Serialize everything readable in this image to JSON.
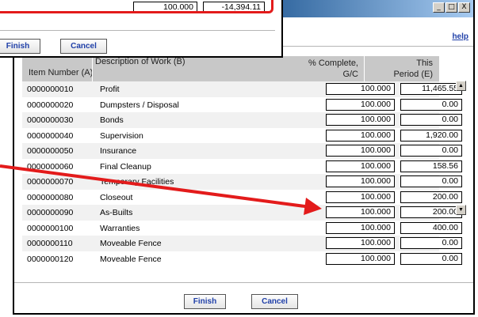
{
  "window": {
    "help_label": "help",
    "controls": [
      "_",
      "□",
      "X"
    ]
  },
  "table": {
    "headers": {
      "item": "Item Number (A)",
      "description": "Description of Work (B)",
      "pct_line1": "% Complete,",
      "pct_line2": "G/C",
      "period_line1": "This",
      "period_line2": "Period (E)"
    },
    "rows": [
      {
        "item": "0000000010",
        "description": "Profit",
        "pct": "100.000",
        "period": "11,465.55"
      },
      {
        "item": "0000000020",
        "description": "Dumpsters / Disposal",
        "pct": "100.000",
        "period": "0.00"
      },
      {
        "item": "0000000030",
        "description": "Bonds",
        "pct": "100.000",
        "period": "0.00"
      },
      {
        "item": "0000000040",
        "description": "Supervision",
        "pct": "100.000",
        "period": "1,920.00"
      },
      {
        "item": "0000000050",
        "description": "Insurance",
        "pct": "100.000",
        "period": "0.00"
      },
      {
        "item": "0000000060",
        "description": "Final Cleanup",
        "pct": "100.000",
        "period": "158.56"
      },
      {
        "item": "0000000070",
        "description": "Temporary Facilities",
        "pct": "100.000",
        "period": "0.00"
      },
      {
        "item": "0000000080",
        "description": "Closeout",
        "pct": "100.000",
        "period": "200.00"
      },
      {
        "item": "0000000090",
        "description": "As-Builts",
        "pct": "100.000",
        "period": "200.00"
      },
      {
        "item": "0000000100",
        "description": "Warranties",
        "pct": "100.000",
        "period": "400.00"
      },
      {
        "item": "0000000110",
        "description": "Moveable Fence",
        "pct": "100.000",
        "period": "0.00"
      },
      {
        "item": "0000000120",
        "description": "Moveable Fence",
        "pct": "100.000",
        "period": "0.00"
      }
    ]
  },
  "buttons": {
    "finish": "Finish",
    "cancel": "Cancel"
  },
  "overlay": {
    "pct": "100.000",
    "period": "-14,394.11",
    "finish": "Finish",
    "cancel": "Cancel"
  },
  "colors": {
    "highlight": "#e31b1b",
    "link": "#1f3fa8"
  }
}
